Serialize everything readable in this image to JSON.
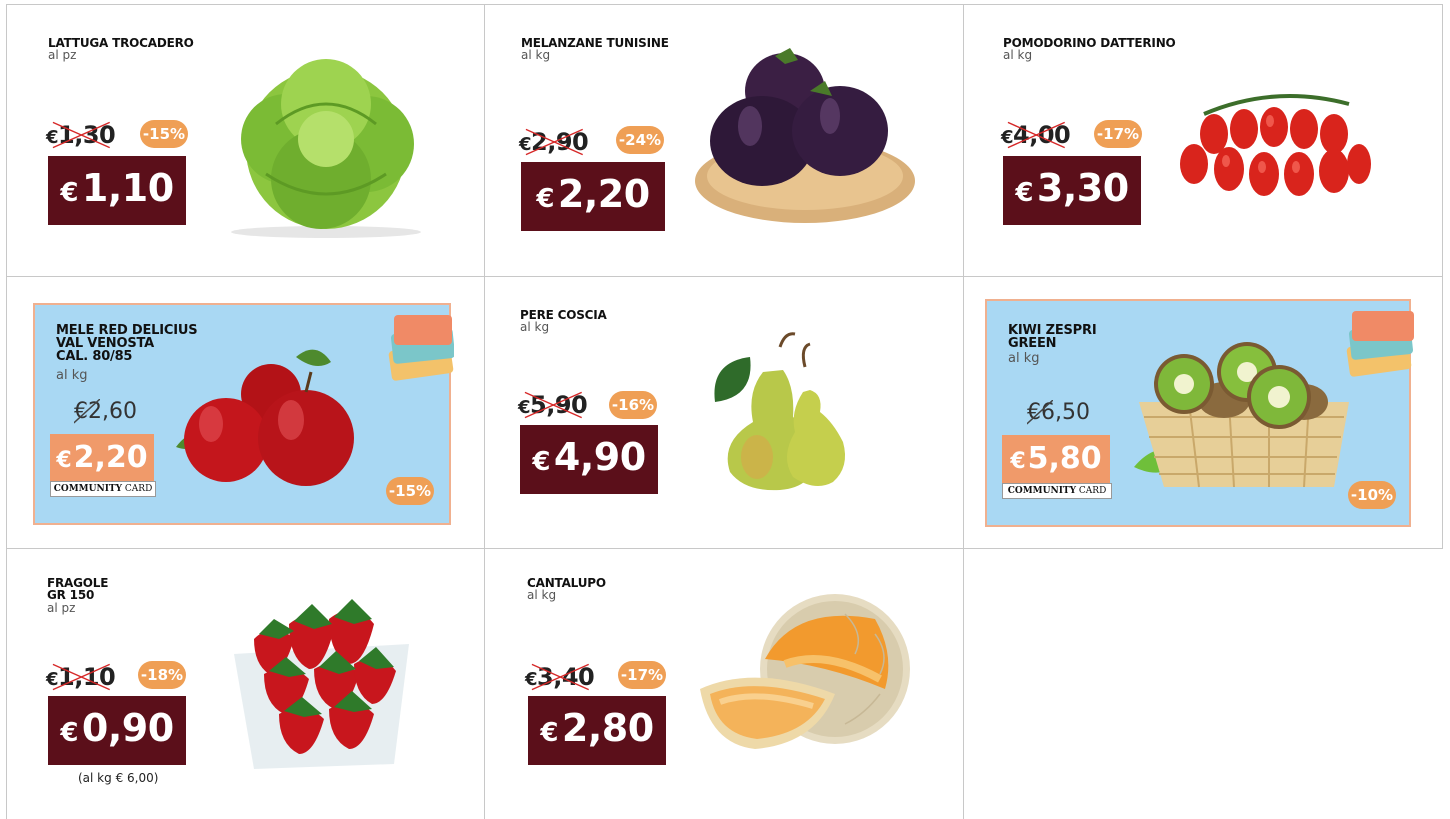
{
  "products": [
    {
      "name_lines": [
        "LATTUGA TROCADERO"
      ],
      "unit": "al pz",
      "old_price": "1,30",
      "discount": "-15%",
      "price": "1,10",
      "currency": "€",
      "image": "lettuce-image"
    },
    {
      "name_lines": [
        "MELANZANE TUNISINE"
      ],
      "unit": "al kg",
      "old_price": "2,90",
      "discount": "-24%",
      "price": "2,20",
      "currency": "€",
      "image": "eggplant-image"
    },
    {
      "name_lines": [
        "POMODORINO DATTERINO"
      ],
      "unit": "al kg",
      "old_price": "4,00",
      "discount": "-17%",
      "price": "3,30",
      "currency": "€",
      "image": "tomato-image"
    },
    {
      "name_lines": [
        "MELE RED DELICIUS",
        "VAL VENOSTA",
        "CAL. 80/85"
      ],
      "unit": "al kg",
      "old_price": "2,60",
      "discount": "-15%",
      "price": "2,20",
      "currency": "€",
      "card_label_bold": "COMMUNITY",
      "card_label_rest": " CARD",
      "image": "apple-image"
    },
    {
      "name_lines": [
        "PERE COSCIA"
      ],
      "unit": "al kg",
      "old_price": "5,90",
      "discount": "-16%",
      "price": "4,90",
      "currency": "€",
      "image": "pear-image"
    },
    {
      "name_lines": [
        "KIWI ZESPRI",
        "GREEN"
      ],
      "unit": "al kg",
      "old_price": "6,50",
      "discount": "-10%",
      "price": "5,80",
      "currency": "€",
      "card_label_bold": "COMMUNITY",
      "card_label_rest": " CARD",
      "image": "kiwi-image"
    },
    {
      "name_lines": [
        "FRAGOLE",
        "GR 150"
      ],
      "unit": "al pz",
      "old_price": "1,10",
      "discount": "-18%",
      "price": "0,90",
      "currency": "€",
      "note": "(al kg € 6,00)",
      "image": "strawberry-image"
    },
    {
      "name_lines": [
        "CANTALUPO"
      ],
      "unit": "al kg",
      "old_price": "3,40",
      "discount": "-17%",
      "price": "2,80",
      "currency": "€",
      "image": "melon-image"
    }
  ],
  "colors": {
    "price_bg": "#5b0f1a",
    "discount_bg": "#ef9f55",
    "promo_bg": "#a9d8f3",
    "cc_price_bg": "#f09a6a",
    "grid_line": "#c8c8c8"
  }
}
